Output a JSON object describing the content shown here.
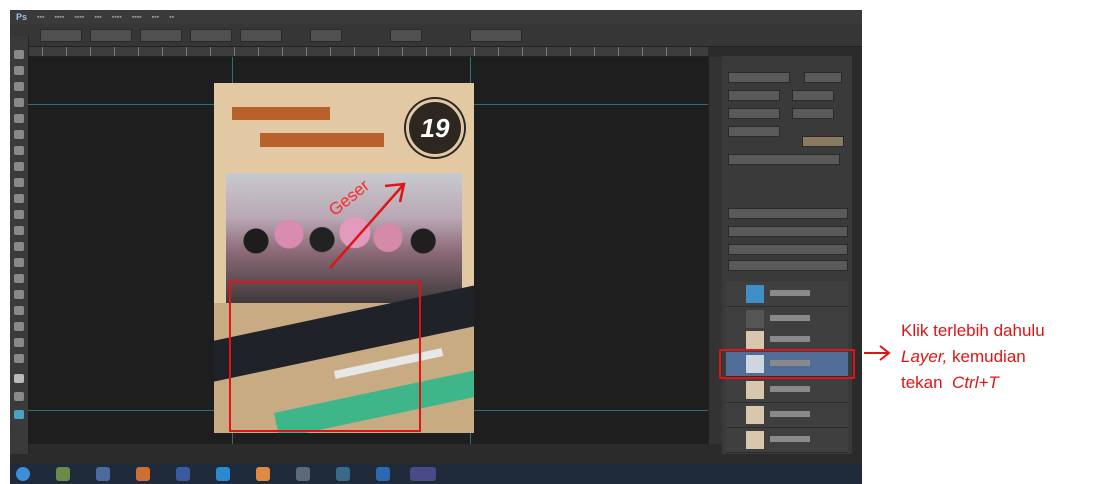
{
  "screenshot": {
    "app": "Photoshop",
    "poster": {
      "badge_number": "19"
    }
  },
  "annotations": {
    "arrow_label": "Geser",
    "note_line1": "Klik terlebih dahulu",
    "note_line2_italic": "Layer,",
    "note_line2_rest": " kemudian",
    "note_line3_plain": "tekan  ",
    "note_line3_italic": "Ctrl+T",
    "highlight_color": "#e01414"
  }
}
